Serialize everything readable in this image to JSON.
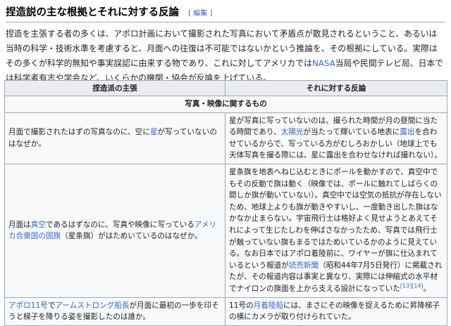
{
  "section": {
    "heading": "捏造説の主な根拠とそれに対する反論",
    "edit_open": "[",
    "edit_label": "編集",
    "edit_close": "]"
  },
  "intro": {
    "t1": "捏造を主張する者の多くは、アポロ計画において撮影された写真において矛盾点が散見されるということ、あるいは当時の科学・技術水準を考慮すると、月面への往復は不可能ではないかという推論を、その根拠にしている。実際はその多くが科学的無知や事実誤認に由来する物であり、これに対してアメリカでは",
    "nasa": "NASA",
    "t2": "当局や民間テレビ局、日本では科学者有志や学会など、いくらかの機関・協会が反論を上げている。"
  },
  "table": {
    "col1_header": "捏造派の主張",
    "col2_header": "それに対する反論",
    "category": "写真・映像に関するもの",
    "rows": [
      {
        "claim": {
          "a": "月面で撮影されたはずの写真なのに、空に",
          "link1": "星",
          "b": "が写っていないのはなぜか。"
        },
        "rebuttal": {
          "a": "星が写真に写っていないのは、撮られた時間が月の昼間に当たる時間であり、",
          "link1": "太陽光",
          "b": "が当たって輝いている地表に",
          "link2": "露出",
          "c": "を合わせているからで、写っている方がむしろおかしい（地球上でも天体写真を撮る際には、星に露出を合わせなければ撮れない）。"
        }
      },
      {
        "claim": {
          "a": "月面は",
          "link1": "真空",
          "b": "であるはずなのに、写真や映像に写っている",
          "link2": "アメリカ合衆国の国旗",
          "c": "（星条旗）がはためいているのはなぜか。"
        },
        "rebuttal": {
          "a": "星条旗を地表へねじ込むときにポールを動かすので、真空中でもその反動で旗は動く（映像では、ポールに触れてしばらくの間しか旗が動いていない）。真空中では空気の抵抗が存在しないため、地球上よりも旗が動きやすいし、一度動き出した旗はなかなか止まらない。宇宙飛行士は格好よく見せようとあえてそれによって生じたしわを伸ばさなかったため、写真では飛行士が触っていない旗もまるではためいているかのように見えている。なお日本ではアポロ着陸前に、ワイヤーが旗に仕込まれているという報道が",
          "link1": "読売新聞",
          "b": "（昭和44年7月5日発行）に掲載されたが、その報道内容は事実と異なり、実際には伸縮式の水平材でナイロンの旗面を上から支える設計になっていた",
          "ref": "[13][14]",
          "c": "。"
        }
      },
      {
        "claim": {
          "link1": "アポロ11号",
          "a": "で",
          "link2": "アームストロング船長",
          "b": "が月面に最初の一歩を印そうと梯子を降りる姿を撮影したのは誰か。"
        },
        "rebuttal": {
          "a": "11号の",
          "link1": "月着陸船",
          "b": "には、まさにその映像を捉えるために昇降梯子の横にカメラが取り付けられていた。"
        }
      }
    ]
  }
}
